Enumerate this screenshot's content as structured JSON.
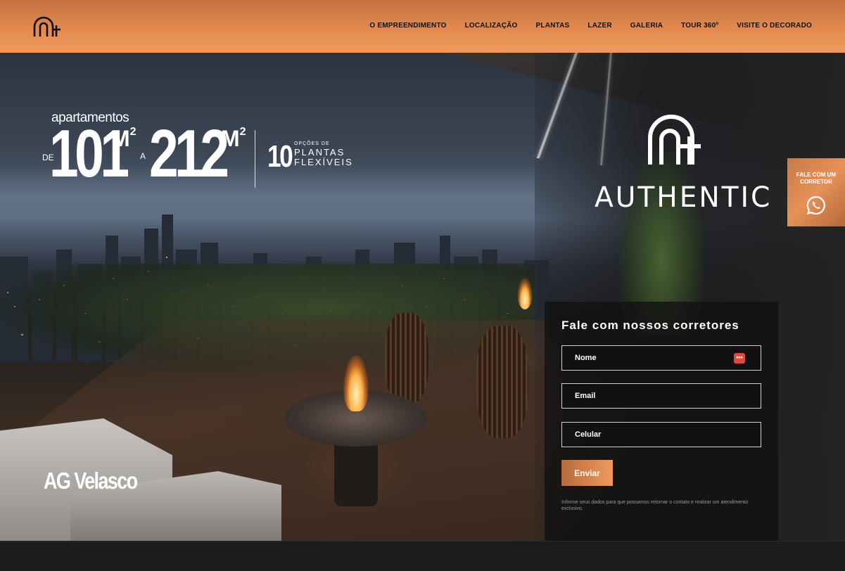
{
  "header": {
    "nav": [
      {
        "label": "O EMPREENDIMENTO"
      },
      {
        "label": "LOCALIZAÇÃO"
      },
      {
        "label": "PLANTAS"
      },
      {
        "label": "LAZER"
      },
      {
        "label": "GALERIA"
      },
      {
        "label": "TOUR 360º"
      },
      {
        "label": "VISITE O DECORADO"
      }
    ]
  },
  "hero": {
    "apartamentos": "apartamentos",
    "de": "DE",
    "size_min": "101",
    "m2_unit": "M",
    "superscript": "2",
    "a": "A",
    "size_max": "212",
    "plan_count": "10",
    "plan_options": "OPÇÕES DE",
    "plan_line1": "PLANTAS",
    "plan_line2": "FLEXÍVEIS",
    "brand": "AUTHENTIC",
    "developer": "AG Velasco"
  },
  "form": {
    "title": "Fale com nossos corretores",
    "name_placeholder": "Nome",
    "email_placeholder": "Email",
    "phone_placeholder": "Celular",
    "submit_label": "Enviar",
    "autofill_icon_text": "•••",
    "disclaimer": "Informe seus dados para que possamos retornar o contato e realizar um atendimento exclusivo."
  },
  "side_cta": {
    "label": "FALE COM UM CORRETOR",
    "icon": "whatsapp-icon"
  },
  "colors": {
    "header_orange": "#e58c52",
    "button_gradient_start": "#b86a3d",
    "button_gradient_end": "#ef9a5c",
    "autofill_red": "#e04a3c"
  }
}
